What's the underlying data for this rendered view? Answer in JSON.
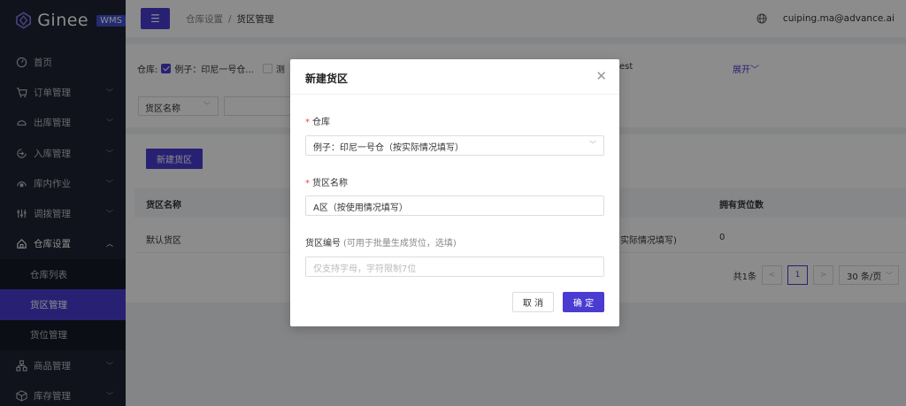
{
  "app": {
    "logo_text": "Ginee",
    "logo_badge": "WMS"
  },
  "sidebar": {
    "items": [
      {
        "label": "首页",
        "icon": "dashboard-icon"
      },
      {
        "label": "订单管理",
        "icon": "cart-icon",
        "expandable": true
      },
      {
        "label": "出库管理",
        "icon": "outbound-icon",
        "expandable": true
      },
      {
        "label": "入库管理",
        "icon": "inbound-icon",
        "expandable": true
      },
      {
        "label": "库内作业",
        "icon": "warehouse-ops-icon",
        "expandable": true
      },
      {
        "label": "调拨管理",
        "icon": "transfer-icon",
        "expandable": true
      },
      {
        "label": "仓库设置",
        "icon": "home-icon",
        "expandable": true,
        "open": true
      },
      {
        "label": "商品管理",
        "icon": "product-icon",
        "expandable": true
      },
      {
        "label": "库存管理",
        "icon": "inventory-icon",
        "expandable": true
      }
    ],
    "sub_items": [
      {
        "label": "仓库列表"
      },
      {
        "label": "货区管理",
        "active": true
      },
      {
        "label": "货位管理"
      }
    ]
  },
  "header": {
    "breadcrumb_parent": "仓库设置",
    "breadcrumb_sep": "/",
    "breadcrumb_current": "货区管理",
    "user_email": "cuiping.ma@advance.ai"
  },
  "filter": {
    "warehouse_label": "仓库:",
    "warehouse_option": "例子：印尼一号仓...",
    "warehouse_option2": "测",
    "test_text": "est",
    "expand_label": "展开",
    "field_select": "货区名称"
  },
  "list": {
    "new_button": "新建货区",
    "columns": [
      "货区名称",
      "拥有货位数"
    ],
    "rows": [
      {
        "name": "默认货区",
        "warehouse_partial": "实际情况填写)",
        "count": "0"
      }
    ],
    "pager": {
      "total": "共1条",
      "current_page": "1",
      "page_size": "30 条/页"
    }
  },
  "modal": {
    "title": "新建货区",
    "warehouse_label": "仓库",
    "warehouse_value": "例子：印尼一号仓（按实际情况填写）",
    "zone_name_label": "货区名称",
    "zone_name_value": "A区（按使用情况填写）",
    "zone_code_label": "货区编号",
    "zone_code_hint": "(可用于批量生成货位，选填)",
    "zone_code_placeholder": "仅支持字母，字符限制7位",
    "cancel_button": "取 消",
    "ok_button": "确 定"
  },
  "colors": {
    "accent": "#4a3cd1",
    "sidebar_bg": "#1f2433",
    "required": "#e5484d"
  }
}
